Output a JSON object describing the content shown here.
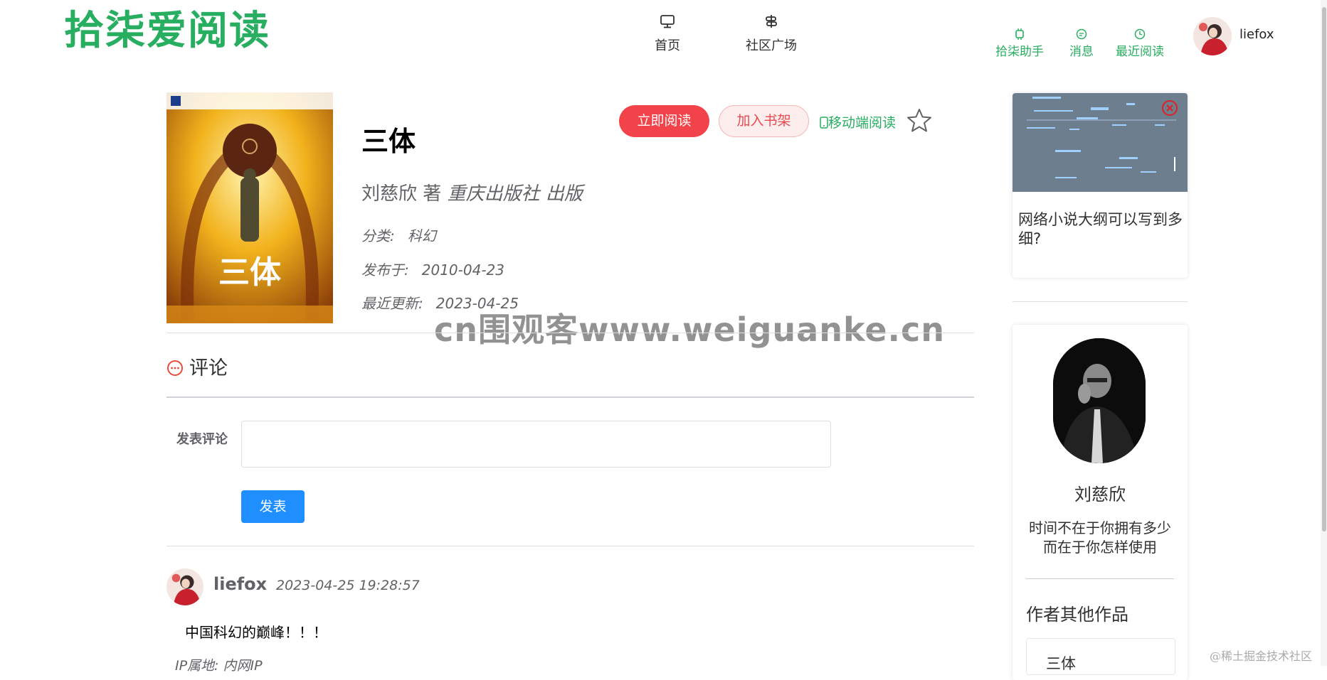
{
  "header": {
    "logo": "拾柒爱阅读",
    "nav": [
      {
        "label": "首页",
        "icon": "monitor-icon"
      },
      {
        "label": "社区广场",
        "icon": "signpost-icon"
      }
    ],
    "links": [
      {
        "label": "拾柒助手",
        "icon": "chip-icon"
      },
      {
        "label": "消息",
        "icon": "chat-icon"
      },
      {
        "label": "最近阅读",
        "icon": "clock-icon"
      }
    ],
    "username": "liefox"
  },
  "book": {
    "title": "三体",
    "author": "刘慈欣",
    "author_suffix": "著",
    "publisher": "重庆出版社",
    "publisher_suffix": "出版",
    "category_label": "分类:",
    "category": "科幻",
    "published_label": "发布于:",
    "published": "2010-04-23",
    "updated_label": "最近更新:",
    "updated": "2023-04-25",
    "read_button": "立即阅读",
    "shelf_button": "加入书架",
    "mobile_read": "移动端阅读"
  },
  "watermark": "cn围观客www.weiguanke.cn",
  "comments": {
    "heading": "评论",
    "post_label": "发表评论",
    "input_value": "",
    "post_button": "发表",
    "items": [
      {
        "user": "liefox",
        "time": "2023-04-25 19:28:57",
        "text": "中国科幻的巅峰！！！",
        "ip_label": "IP属地:",
        "ip": "内网IP"
      }
    ]
  },
  "sidebar": {
    "ad_title": "网络小说大纲可以写到多细?",
    "author_name": "刘慈欣",
    "author_quote_line1": "时间不在于你拥有多少",
    "author_quote_line2": "而在于你怎样使用",
    "other_works_title": "作者其他作品",
    "other_works": [
      "三体"
    ]
  },
  "footer_watermark": "@稀土掘金技术社区",
  "colors": {
    "brand_green": "#27ae60",
    "read_red": "#f2434a",
    "post_blue": "#1f8fff"
  }
}
